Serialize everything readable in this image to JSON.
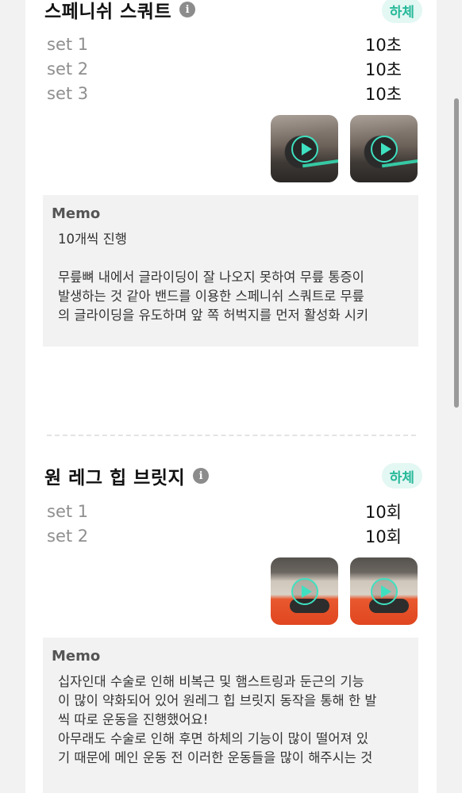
{
  "exercises": [
    {
      "name": "스페니쉬 스쿼트",
      "tag": "하체",
      "sets": [
        {
          "label": "set 1",
          "value": "10초"
        },
        {
          "label": "set 2",
          "value": "10초"
        },
        {
          "label": "set 3",
          "value": "10초"
        }
      ],
      "memo_title": "Memo",
      "memo_text": "10개씩 진행\n\n무릎뼈 내에서 글라이딩이 잘 나오지 못하여 무릎 통증이\n발생하는 것 같아 밴드를 이용한 스페니쉬 스쿼트로 무릎\n의 글라이딩을 유도하며 앞 쪽 허벅지를 먼저 활성화 시키"
    },
    {
      "name": "원 레그 힙 브릿지",
      "tag": "하체",
      "sets": [
        {
          "label": "set 1",
          "value": "10회"
        },
        {
          "label": "set 2",
          "value": "10회"
        }
      ],
      "memo_title": "Memo",
      "memo_text": "십자인대 수술로 인해 비복근 및 햄스트링과 둔근의 기능\n이 많이 약화되어 있어 원레그 힙 브릿지 동작을 통해 한 발\n씩 따로 운동을 진행했어요!\n아무래도 수술로 인해 후면 하체의 기능이 많이 떨어져 있\n기 때문에 메인 운동 전 이러한 운동들을 많이 해주시는 것"
    }
  ],
  "icons": {
    "info": "i",
    "play": "play-icon"
  },
  "colors": {
    "accent": "#27b99a",
    "tag_bg": "#e3f7f3",
    "play": "#3fe0c0"
  }
}
